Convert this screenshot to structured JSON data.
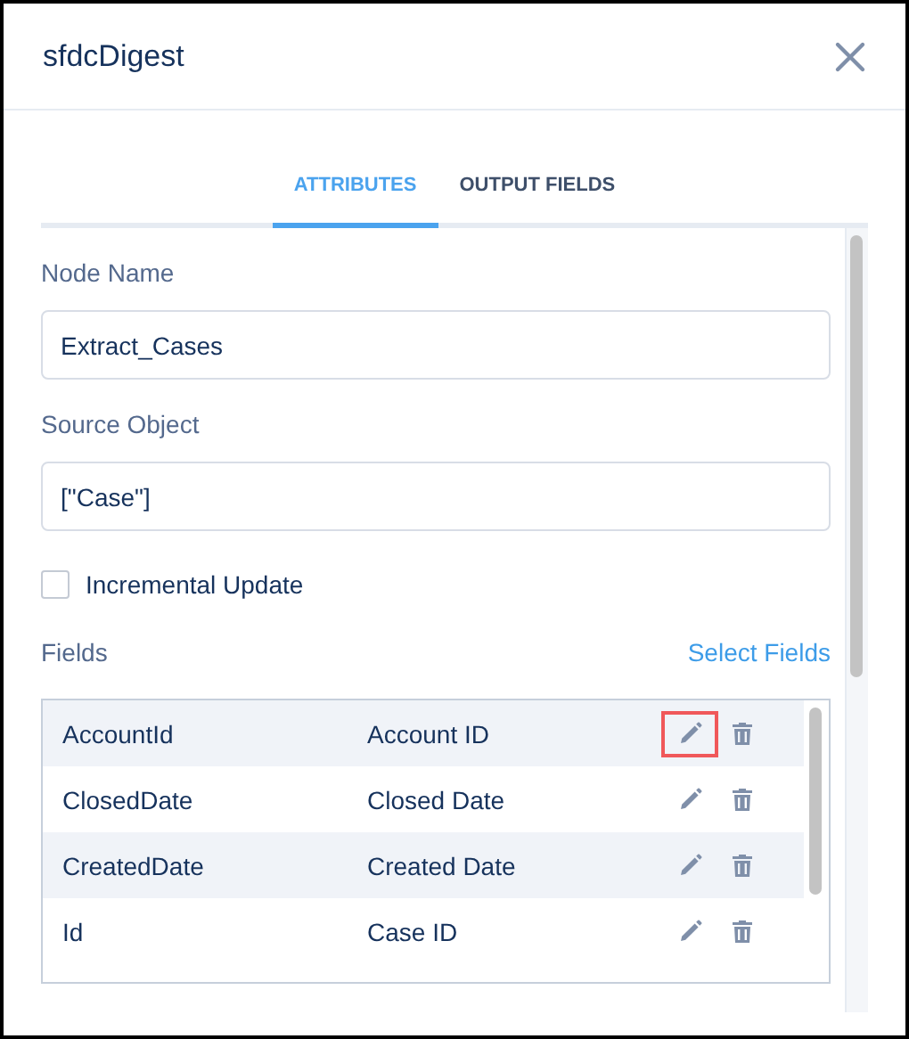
{
  "dialog": {
    "title": "sfdcDigest"
  },
  "tabs": [
    {
      "label": "ATTRIBUTES",
      "selected": true
    },
    {
      "label": "OUTPUT FIELDS",
      "selected": false
    }
  ],
  "node_name": {
    "label": "Node Name",
    "value": "Extract_Cases"
  },
  "source_object": {
    "label": "Source Object",
    "value": "[\"Case\"]"
  },
  "incremental_update": {
    "label": "Incremental Update",
    "checked": false
  },
  "fields": {
    "label": "Fields",
    "link": "Select Fields",
    "rows": [
      {
        "name": "AccountId",
        "label": "Account ID",
        "edit_highlighted": true
      },
      {
        "name": "ClosedDate",
        "label": "Closed Date",
        "edit_highlighted": false
      },
      {
        "name": "CreatedDate",
        "label": "Created Date",
        "edit_highlighted": false
      },
      {
        "name": "Id",
        "label": "Case ID",
        "edit_highlighted": false
      }
    ]
  }
}
